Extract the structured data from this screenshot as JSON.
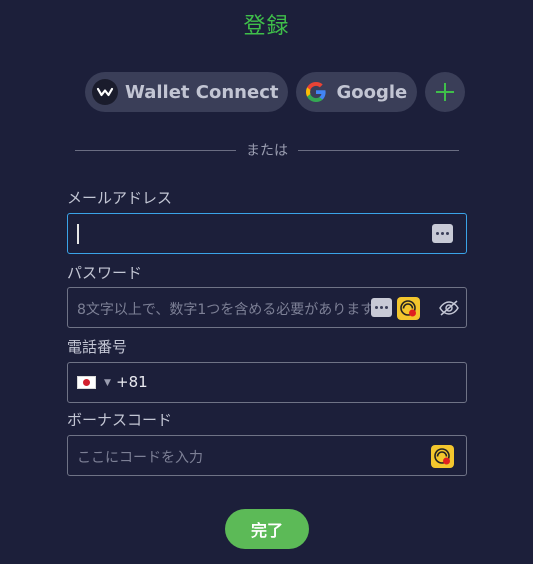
{
  "title": "登録",
  "social": {
    "walletconnect_label": "Wallet Connect",
    "google_label": "Google"
  },
  "divider_text": "または",
  "email": {
    "label": "メールアドレス",
    "value": ""
  },
  "password": {
    "label": "パスワード",
    "placeholder": "8文字以上で、数字1つを含める必要があります"
  },
  "phone": {
    "label": "電話番号",
    "country_code": "+81"
  },
  "bonus": {
    "label": "ボーナスコード",
    "placeholder": "ここにコードを入力"
  },
  "submit_label": "完了",
  "colors": {
    "background": "#1c1f3a",
    "accent_green": "#3fbf4a",
    "button_green": "#5cba57",
    "focus_blue": "#3aa3e8"
  }
}
